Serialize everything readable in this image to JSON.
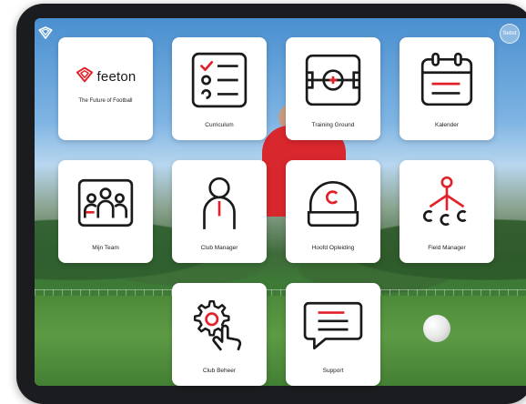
{
  "brand": {
    "name": "feeton",
    "tagline": "The Future of Football"
  },
  "header": {
    "badge_text": "Sebst"
  },
  "tiles": [
    {
      "label": "Curriculum",
      "icon": "checklist-icon"
    },
    {
      "label": "Training Ground",
      "icon": "training-ground-icon"
    },
    {
      "label": "Kalender",
      "icon": "calendar-icon"
    },
    {
      "label": "Mijn Team",
      "icon": "team-icon"
    },
    {
      "label": "Club Manager",
      "icon": "person-tie-icon"
    },
    {
      "label": "Hoofd Opleiding",
      "icon": "cap-icon"
    },
    {
      "label": "Field Manager",
      "icon": "hierarchy-icon"
    },
    {
      "label": "Club Beheer",
      "icon": "gear-touch-icon"
    },
    {
      "label": "Support",
      "icon": "chat-icon"
    }
  ],
  "colors": {
    "accent": "#e2222a",
    "ink": "#1a1a1a",
    "tile_bg": "#ffffff",
    "device": "#1b1c1f"
  }
}
